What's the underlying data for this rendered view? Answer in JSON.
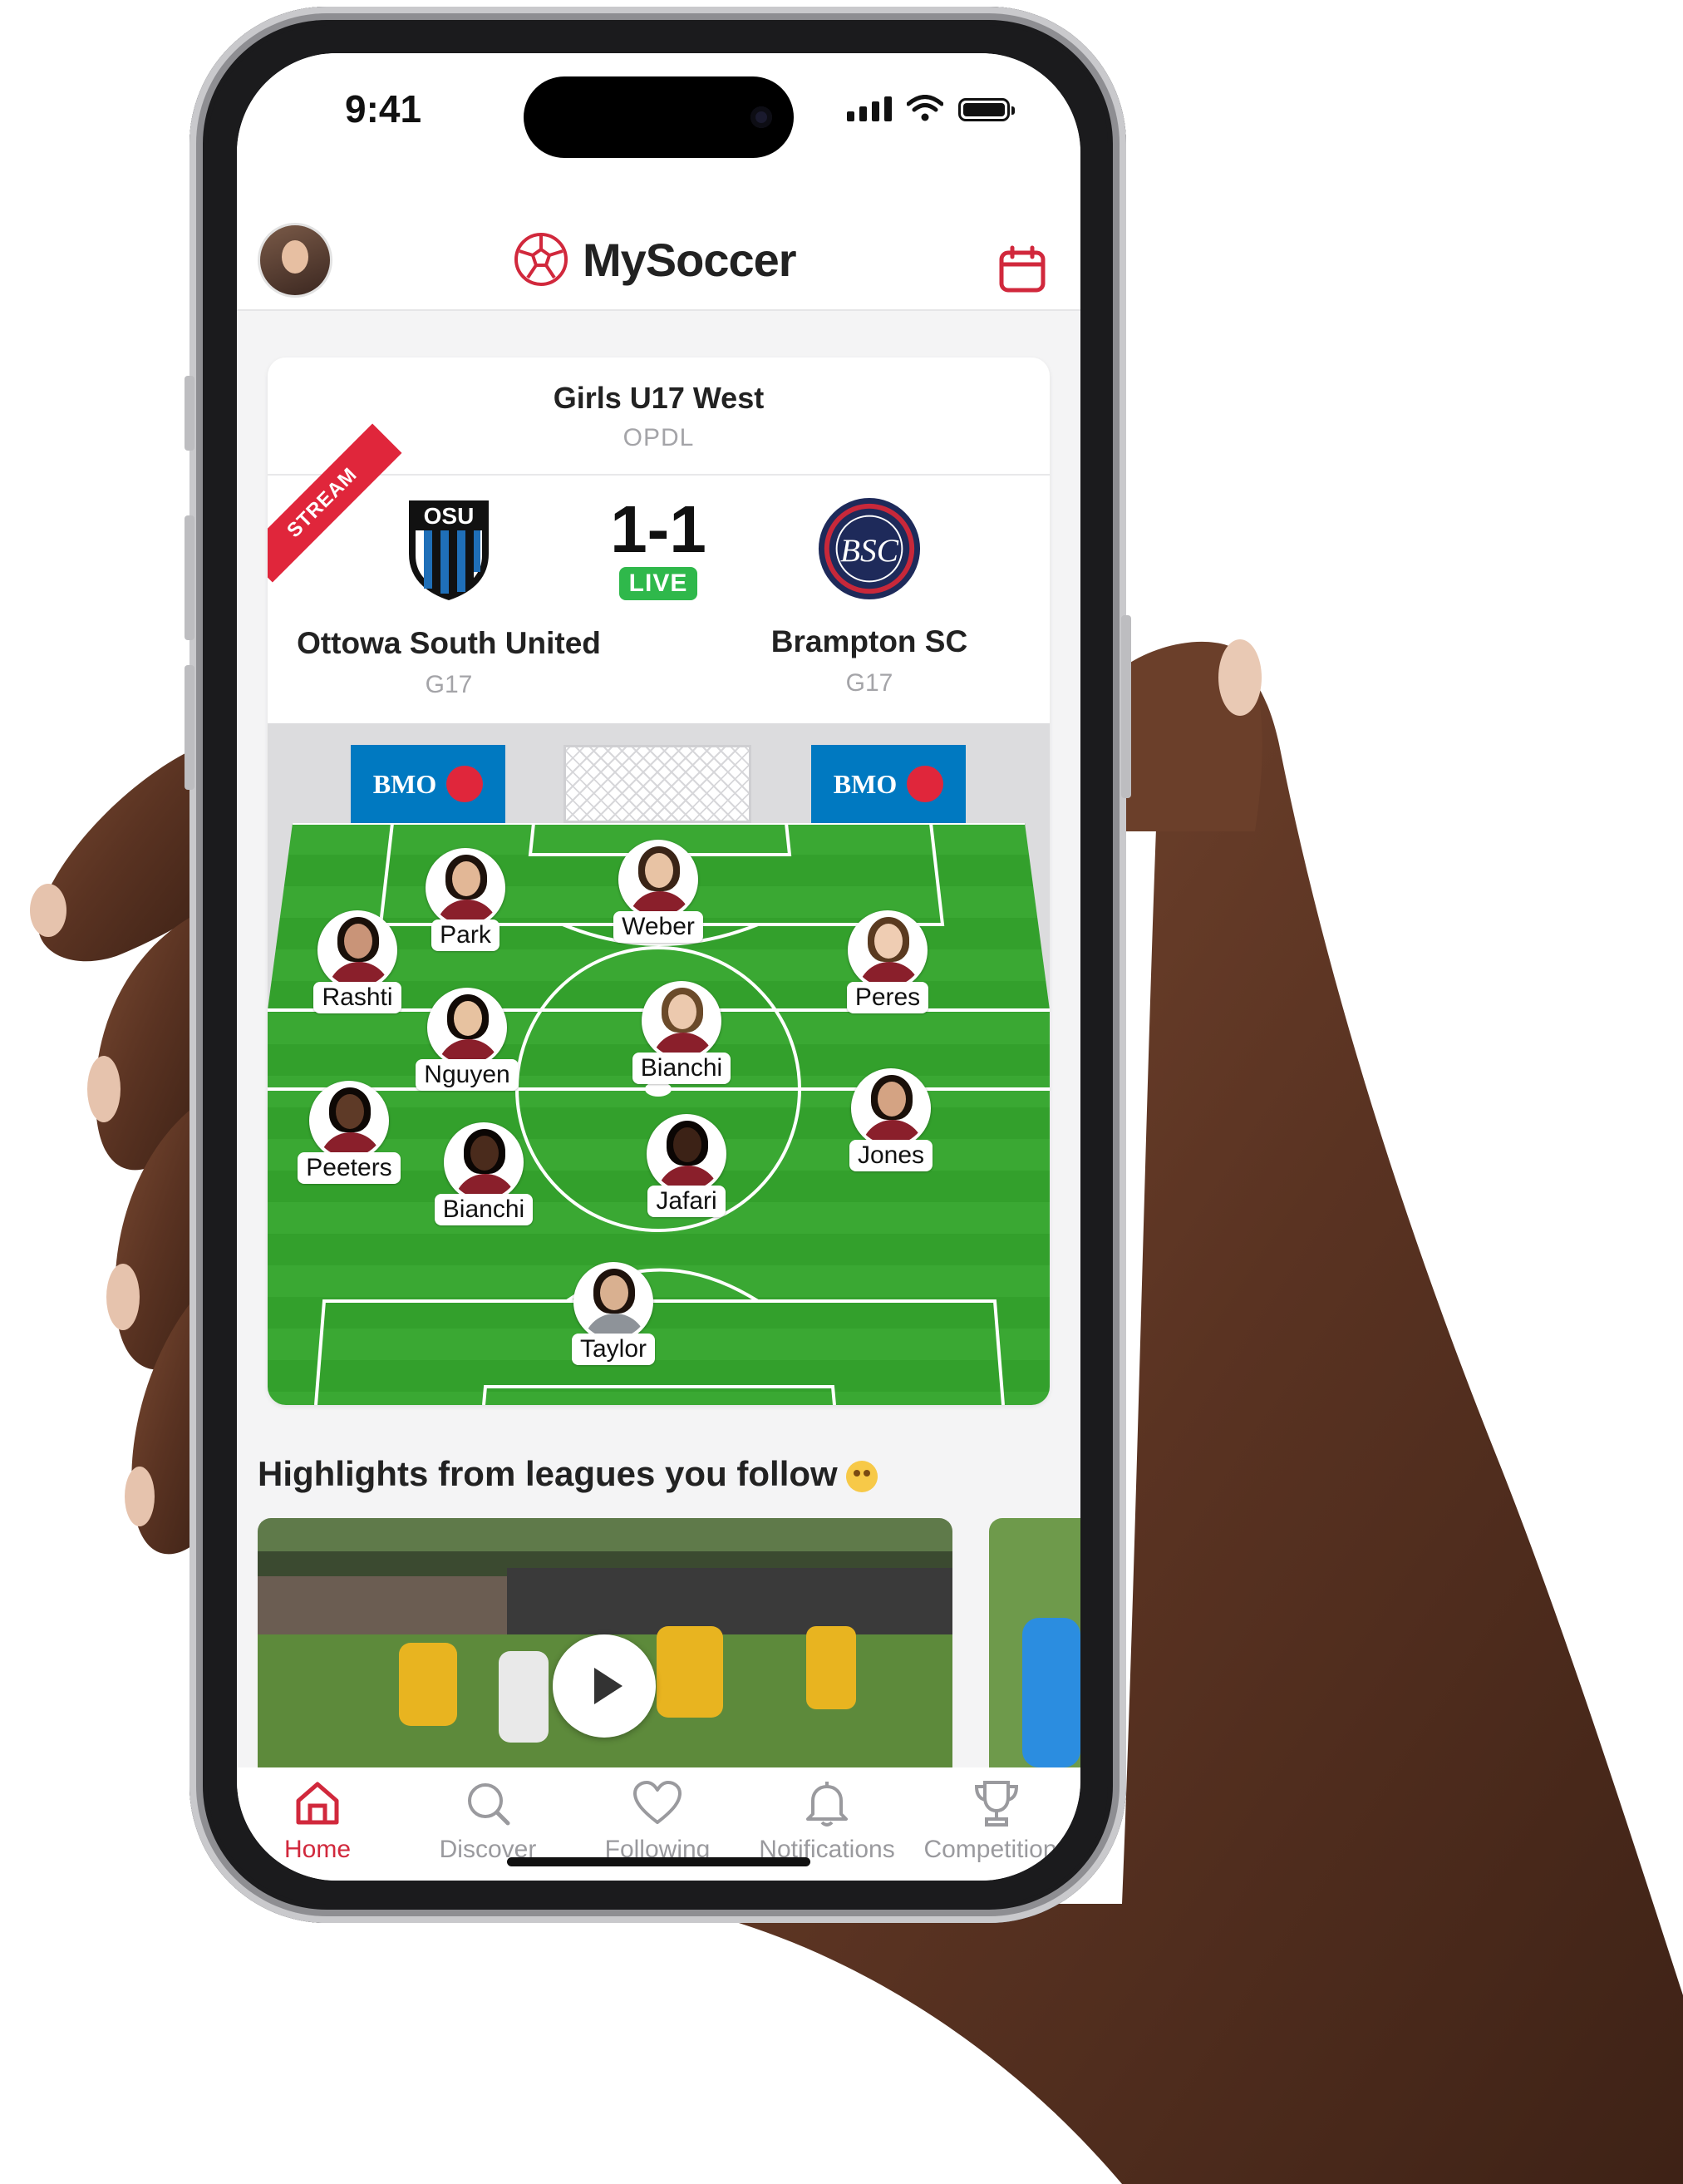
{
  "status_bar": {
    "time": "9:41"
  },
  "app": {
    "title": "MySoccer",
    "accent_color": "#d1283c"
  },
  "header": {
    "avatar_icon": "user-avatar",
    "calendar_icon": "calendar-icon"
  },
  "match": {
    "league": "Girls U17 West",
    "organization": "OPDL",
    "badge": "STREAM",
    "score": "1-1",
    "status": "LIVE",
    "home": {
      "name": "Ottowa South United",
      "age_group": "G17",
      "crest_text": "OSU"
    },
    "away": {
      "name": "Brampton SC",
      "age_group": "G17",
      "crest_text": "BSC"
    }
  },
  "sponsor": {
    "name": "BMO"
  },
  "lineup": [
    {
      "name": "Park"
    },
    {
      "name": "Weber"
    },
    {
      "name": "Rashti"
    },
    {
      "name": "Peres"
    },
    {
      "name": "Nguyen"
    },
    {
      "name": "Bianchi"
    },
    {
      "name": "Peeters"
    },
    {
      "name": "Jones"
    },
    {
      "name": "Bianchi"
    },
    {
      "name": "Jafari"
    },
    {
      "name": "Taylor"
    }
  ],
  "highlights": {
    "title": "Highlights from leagues you follow"
  },
  "tabs": [
    {
      "label": "Home",
      "icon": "home-icon",
      "active": true
    },
    {
      "label": "Discover",
      "icon": "search-icon"
    },
    {
      "label": "Following",
      "icon": "heart-icon"
    },
    {
      "label": "Notifications",
      "icon": "bell-icon"
    },
    {
      "label": "Competitions",
      "icon": "trophy-icon"
    }
  ]
}
